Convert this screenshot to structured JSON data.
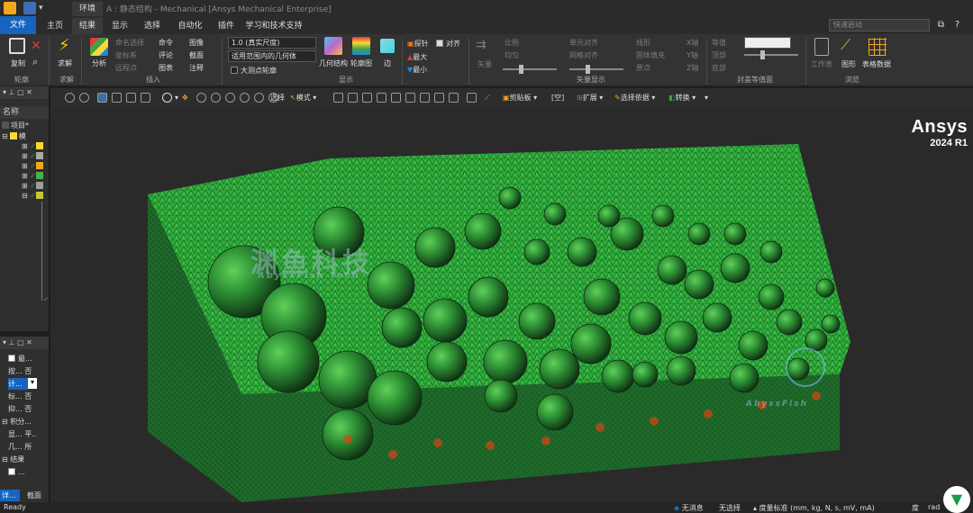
{
  "window": {
    "title": "A : 静态结构 - Mechanical [Ansys Mechanical Enterprise]",
    "context_tab": "环境"
  },
  "ribbon_tabs": [
    {
      "label": "文件",
      "kind": "file"
    },
    {
      "label": "主页"
    },
    {
      "label": "结果",
      "active": true
    },
    {
      "label": "显示"
    },
    {
      "label": "选择"
    },
    {
      "label": "自动化"
    },
    {
      "label": "插件"
    },
    {
      "label": "学习和技术支持"
    }
  ],
  "quick_launch_placeholder": "快速启动",
  "ribbon": {
    "groups": {
      "outline": "轮廓",
      "solve": "求解",
      "insert": "插入",
      "display": "显示",
      "vector_display": "矢量显示",
      "capped_isosurface": "封盖等值面",
      "browse": "浏览"
    },
    "outline": {
      "copy": "复制"
    },
    "solve": {
      "solve": "求解"
    },
    "insert": {
      "analysis": "分析",
      "named_selection": "命名选择",
      "coordinate_system": "坐标系",
      "remote_point": "远程点",
      "command": "命令",
      "comment": "评论",
      "chart": "图表",
      "image": "图像",
      "section": "截面",
      "annotation": "注释"
    },
    "display": {
      "scale_value": "1.0 (真实尺度)",
      "geometry_scope": "适用范围内的几何体",
      "max_contour": "大测点轮廓",
      "geometry": "几何结构",
      "contour": "轮廓图",
      "edges": "边"
    },
    "probe": {
      "probe": "探针",
      "max": "最大",
      "min": "最小",
      "align": "对齐"
    },
    "vector": {
      "vector": "矢量",
      "proportional": "比例",
      "uniform": "均匀",
      "element_aligned": "单元对齐",
      "grid_aligned": "网格对齐"
    },
    "vector2": {
      "line": "线形",
      "solid_fill": "固体填充",
      "origin": "原点",
      "x_axis": "X轴",
      "y_axis": "Y轴",
      "z_axis": "Z轴"
    },
    "capped": {
      "isoline": "等值",
      "top": "顶部",
      "bottom": "底部"
    },
    "browse": {
      "worksheet": "工作表",
      "graph": "图形",
      "tabular_data": "表格数据"
    }
  },
  "outline_panel": {
    "header": "名称",
    "root_label": "项目*",
    "model_label": "模"
  },
  "details_panel": {
    "rows": [
      "最...",
      "按...",
      "计...",
      "标...",
      "抑...",
      "积分...",
      "显...",
      "几...",
      "结果",
      "..."
    ],
    "values": [
      "否",
      "否",
      "否",
      "否",
      "平..",
      "所"
    ],
    "section_tabs": [
      "详...",
      "截面"
    ]
  },
  "graphics_toolbar": {
    "select": "选择",
    "mode": "模式",
    "clipboard": "剪贴板",
    "empty": "[空]",
    "extend": "扩展",
    "select_by": "选择依据",
    "convert": "转换"
  },
  "viewport": {
    "brand": "Ansys",
    "version": "2024 R1",
    "watermark_cn": "渊鱼科技",
    "watermark_en": "AbyssFish Tech",
    "watermark_logo_text": "AbyssFish"
  },
  "status_bar": {
    "ready": "Ready",
    "no_messages": "无消息",
    "no_selection": "无选择",
    "units": "度量标准 (mm, kg, N, s, mV, mA)",
    "angle": "度",
    "rad": "rad"
  },
  "colors": {
    "accent": "#1565c0",
    "mesh_green": "#3cc43a",
    "mesh_dark": "#1b4a24",
    "ribbon_bg": "#333333"
  }
}
